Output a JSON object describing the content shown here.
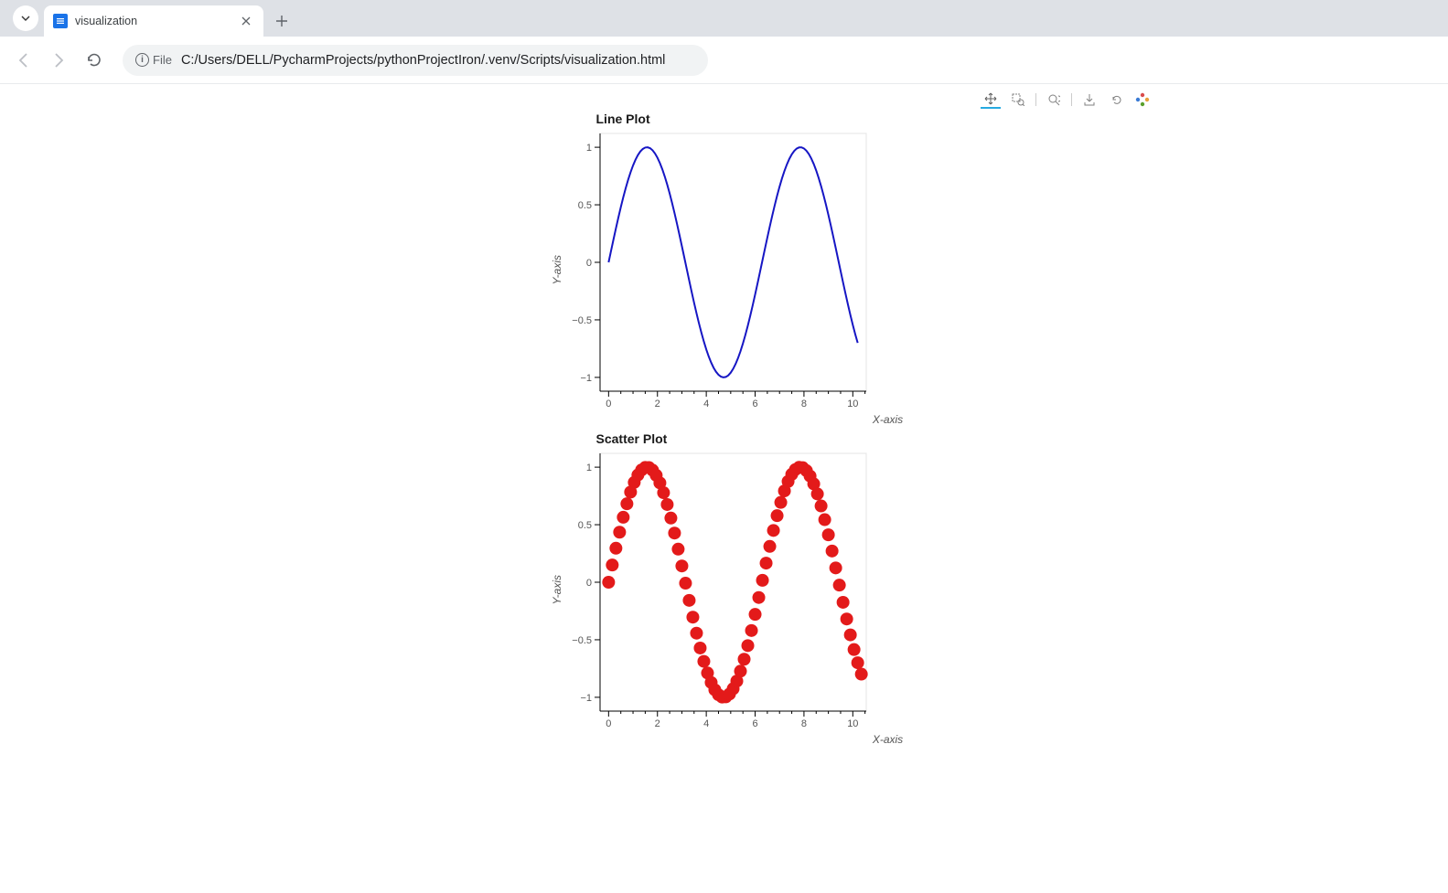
{
  "browser": {
    "tab_title": "visualization",
    "file_label": "File",
    "url": "C:/Users/DELL/PycharmProjects/pythonProjectIron/.venv/Scripts/visualization.html"
  },
  "toolbar": {
    "tools": [
      "pan",
      "box-zoom",
      "wheel-zoom",
      "save",
      "reset"
    ],
    "active": "pan"
  },
  "chart_data": [
    {
      "type": "line",
      "title": "Line Plot",
      "xlabel": "X-axis",
      "ylabel": "Y-axis",
      "xlim": [
        -0.35,
        10.55
      ],
      "ylim": [
        -1.12,
        1.12
      ],
      "xticks": [
        0,
        2,
        4,
        6,
        8,
        10
      ],
      "yticks": [
        -1,
        -0.5,
        0,
        0.5,
        1
      ],
      "yticklabels": [
        "−1",
        "−0.5",
        "0",
        "0.5",
        "1"
      ],
      "x": [
        0.0,
        0.1,
        0.2,
        0.3,
        0.4,
        0.5,
        0.6,
        0.7,
        0.8,
        0.9,
        1.0,
        1.1,
        1.2,
        1.3,
        1.4,
        1.5,
        1.6,
        1.7,
        1.8,
        1.9,
        2.0,
        2.1,
        2.2,
        2.3,
        2.4,
        2.5,
        2.6,
        2.7,
        2.8,
        2.9,
        3.0,
        3.1,
        3.2,
        3.3,
        3.4,
        3.5,
        3.6,
        3.7,
        3.8,
        3.9,
        4.0,
        4.1,
        4.2,
        4.3,
        4.4,
        4.5,
        4.6,
        4.7,
        4.8,
        4.9,
        5.0,
        5.1,
        5.2,
        5.3,
        5.4,
        5.5,
        5.6,
        5.7,
        5.8,
        5.9,
        6.0,
        6.1,
        6.2,
        6.3,
        6.4,
        6.5,
        6.6,
        6.7,
        6.8,
        6.9,
        7.0,
        7.1,
        7.2,
        7.3,
        7.4,
        7.5,
        7.6,
        7.7,
        7.8,
        7.9,
        8.0,
        8.1,
        8.2,
        8.3,
        8.4,
        8.5,
        8.6,
        8.7,
        8.8,
        8.9,
        9.0,
        9.1,
        9.2,
        9.3,
        9.4,
        9.5,
        9.6,
        9.7,
        9.8,
        9.9,
        10.0,
        10.1,
        10.2
      ],
      "y": [
        0.0,
        0.0998,
        0.1987,
        0.2955,
        0.3894,
        0.4794,
        0.5646,
        0.6442,
        0.7174,
        0.7833,
        0.8415,
        0.8912,
        0.932,
        0.9636,
        0.9854,
        0.9975,
        0.9996,
        0.9917,
        0.9738,
        0.9463,
        0.9093,
        0.8632,
        0.8085,
        0.7457,
        0.6755,
        0.5985,
        0.5155,
        0.4274,
        0.335,
        0.2392,
        0.1411,
        0.0416,
        -0.0584,
        -0.1577,
        -0.2555,
        -0.3508,
        -0.4425,
        -0.5298,
        -0.6119,
        -0.6878,
        -0.7568,
        -0.8183,
        -0.8716,
        -0.9162,
        -0.9516,
        -0.9775,
        -0.9937,
        -0.9999,
        -0.9962,
        -0.9825,
        -0.9589,
        -0.9258,
        -0.8835,
        -0.8323,
        -0.7728,
        -0.7055,
        -0.6313,
        -0.5507,
        -0.4646,
        -0.3739,
        -0.2794,
        -0.1822,
        -0.0831,
        0.0168,
        0.1165,
        0.2151,
        0.3115,
        0.4048,
        0.4941,
        0.5784,
        0.657,
        0.729,
        0.7937,
        0.8504,
        0.8987,
        0.938,
        0.9679,
        0.9882,
        0.9985,
        0.9989,
        0.9894,
        0.9699,
        0.9407,
        0.9022,
        0.8546,
        0.7985,
        0.7344,
        0.663,
        0.5849,
        0.501,
        0.4121,
        0.3191,
        0.2229,
        0.1245,
        0.0248,
        -0.0752,
        -0.1743,
        -0.2718,
        -0.3665,
        -0.4575,
        -0.544,
        -0.6251,
        -0.7
      ],
      "color": "#1616c4"
    },
    {
      "type": "scatter",
      "title": "Scatter Plot",
      "xlabel": "X-axis",
      "ylabel": "Y-axis",
      "xlim": [
        -0.35,
        10.55
      ],
      "ylim": [
        -1.12,
        1.12
      ],
      "xticks": [
        0,
        2,
        4,
        6,
        8,
        10
      ],
      "yticks": [
        -1,
        -0.5,
        0,
        0.5,
        1
      ],
      "yticklabels": [
        "−1",
        "−0.5",
        "0",
        "0.5",
        "1"
      ],
      "n": 70,
      "x_start": 0.0,
      "x_step": 0.15,
      "marker_radius": 7,
      "color": "#e31a1a"
    }
  ]
}
